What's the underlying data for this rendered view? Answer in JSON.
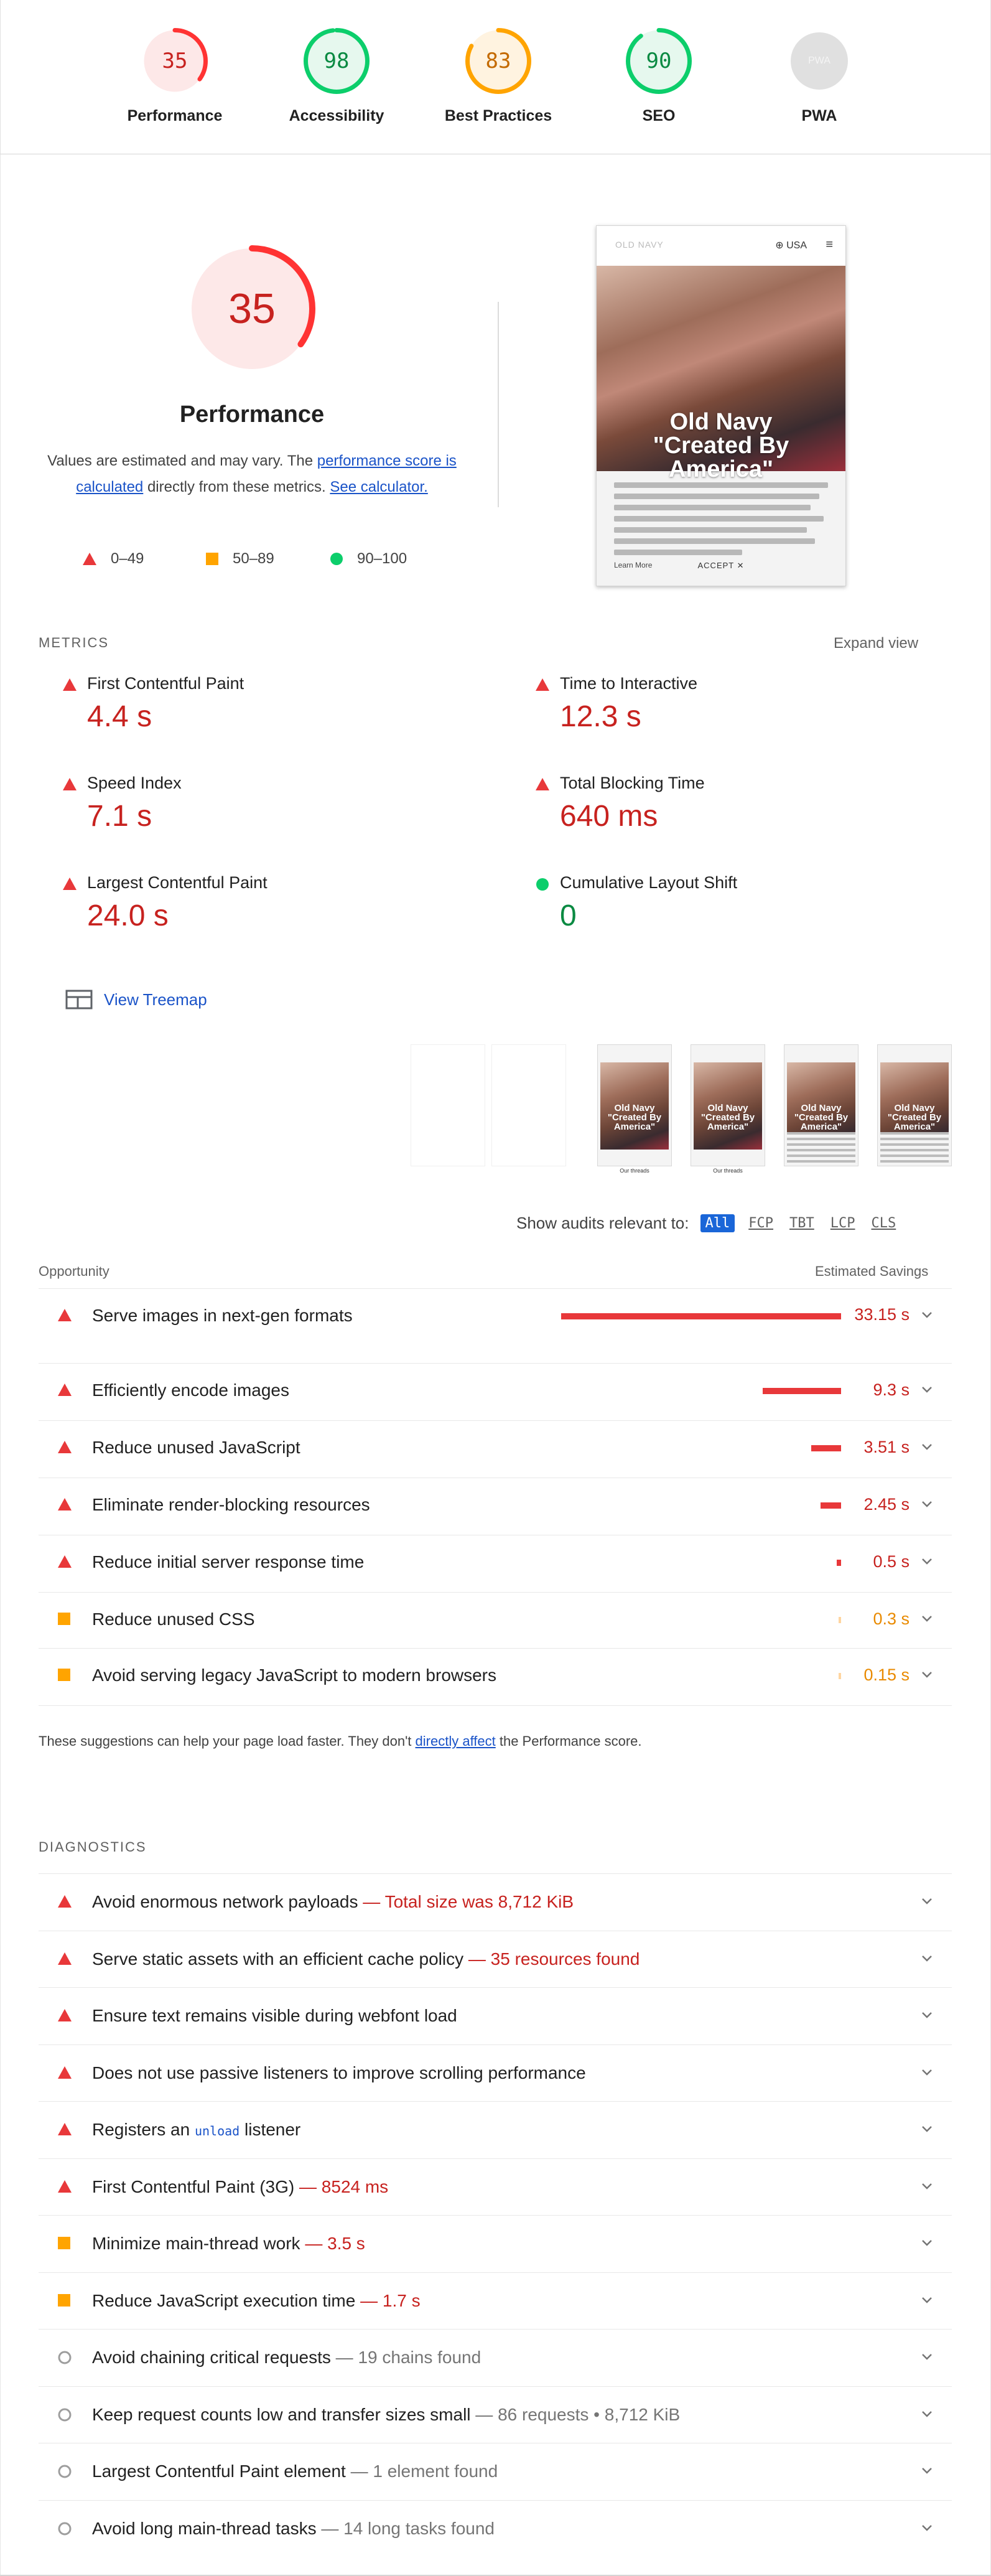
{
  "colors": {
    "fail": "#c7221f",
    "fail_bar": "#e8383a",
    "average": "#e98a00",
    "pass": "#0a8a42",
    "link": "#1a53c8",
    "pwa_gray": "#e0e0e0"
  },
  "gauges": [
    {
      "score": "35",
      "label": "Performance",
      "fraction": 0.35,
      "tone": "fail"
    },
    {
      "score": "98",
      "label": "Accessibility",
      "fraction": 0.98,
      "tone": "pass"
    },
    {
      "score": "83",
      "label": "Best Practices",
      "fraction": 0.83,
      "tone": "average"
    },
    {
      "score": "90",
      "label": "SEO",
      "fraction": 0.9,
      "tone": "pass"
    },
    {
      "score": "PWA",
      "label": "PWA",
      "fraction": 0,
      "tone": "gray"
    }
  ],
  "hero": {
    "score": "35",
    "fraction": 0.35,
    "title": "Performance",
    "desc_1": "Values are estimated and may vary. The ",
    "link_1": "performance score is calculated",
    "desc_2": " directly from these metrics. ",
    "link_2": "See calculator.",
    "legend": [
      {
        "range": "0–49",
        "icon": "triangle-icon"
      },
      {
        "range": "50–89",
        "icon": "square-icon"
      },
      {
        "range": "90–100",
        "icon": "circle-icon"
      }
    ]
  },
  "final_screenshot": {
    "brand": "OLD NAVY",
    "locale": "USA",
    "headline_1": "Old Navy",
    "headline_2": "\"Created By",
    "headline_3": "America\"",
    "learn_more": "Learn More",
    "accept": "ACCEPT ✕"
  },
  "metrics": {
    "label": "METRICS",
    "expand": "Expand view",
    "items": [
      {
        "title": "First Contentful Paint",
        "value": "4.4 s",
        "status": "fail"
      },
      {
        "title": "Time to Interactive",
        "value": "12.3 s",
        "status": "fail"
      },
      {
        "title": "Speed Index",
        "value": "7.1 s",
        "status": "fail"
      },
      {
        "title": "Total Blocking Time",
        "value": "640 ms",
        "status": "fail"
      },
      {
        "title": "Largest Contentful Paint",
        "value": "24.0 s",
        "status": "fail"
      },
      {
        "title": "Cumulative Layout Shift",
        "value": "0",
        "status": "pass"
      }
    ],
    "treemap": "View Treemap"
  },
  "filmstrip": {
    "caption": "Our threads",
    "headline": "Old Navy \"Created By America\""
  },
  "filter": {
    "label": "Show audits relevant to:",
    "chips": [
      "All",
      "FCP",
      "TBT",
      "LCP",
      "CLS"
    ],
    "active": "All"
  },
  "opportunities": {
    "header": "Opportunity",
    "savings_header": "Estimated Savings",
    "items": [
      {
        "title": "Serve images in next-gen formats",
        "savings": "33.15 s",
        "savings_s": 33.15,
        "status": "fail"
      },
      {
        "title": "Efficiently encode images",
        "savings": "9.3 s",
        "savings_s": 9.3,
        "status": "fail"
      },
      {
        "title": "Reduce unused JavaScript",
        "savings": "3.51 s",
        "savings_s": 3.51,
        "status": "fail"
      },
      {
        "title": "Eliminate render-blocking resources",
        "savings": "2.45 s",
        "savings_s": 2.45,
        "status": "fail"
      },
      {
        "title": "Reduce initial server response time",
        "savings": "0.5 s",
        "savings_s": 0.5,
        "status": "fail"
      },
      {
        "title": "Reduce unused CSS",
        "savings": "0.3 s",
        "savings_s": 0.3,
        "status": "average"
      },
      {
        "title": "Avoid serving legacy JavaScript to modern browsers",
        "savings": "0.15 s",
        "savings_s": 0.15,
        "status": "average"
      }
    ],
    "hint_1": "These suggestions can help your page load faster. They don't ",
    "hint_link": "directly affect",
    "hint_2": " the Performance score."
  },
  "diagnostics": {
    "label": "DIAGNOSTICS",
    "items": [
      {
        "title": "Avoid enormous network payloads",
        "sub": " — Total size was 8,712 KiB",
        "status": "fail"
      },
      {
        "title": "Serve static assets with an efficient cache policy",
        "sub": " — 35 resources found",
        "status": "fail"
      },
      {
        "title": "Ensure text remains visible during webfont load",
        "sub": "",
        "status": "fail"
      },
      {
        "title": "Does not use passive listeners to improve scrolling performance",
        "sub": "",
        "status": "fail"
      },
      {
        "title": "Registers an ",
        "code": "unload",
        "tail": " listener",
        "sub": "",
        "status": "fail"
      },
      {
        "title": "First Contentful Paint (3G)",
        "sub": " — 8524 ms",
        "status": "fail"
      },
      {
        "title": "Minimize main-thread work",
        "sub": " — 3.5 s",
        "status": "average"
      },
      {
        "title": "Reduce JavaScript execution time",
        "sub": " — 1.7 s",
        "status": "average"
      },
      {
        "title": "Avoid chaining critical requests",
        "sub": " — 19 chains found",
        "status": "info"
      },
      {
        "title": "Keep request counts low and transfer sizes small",
        "sub": " — 86 requests • 8,712 KiB",
        "status": "info"
      },
      {
        "title": "Largest Contentful Paint element",
        "sub": " — 1 element found",
        "status": "info"
      },
      {
        "title": "Avoid long main-thread tasks",
        "sub": " — 14 long tasks found",
        "status": "info"
      }
    ]
  }
}
